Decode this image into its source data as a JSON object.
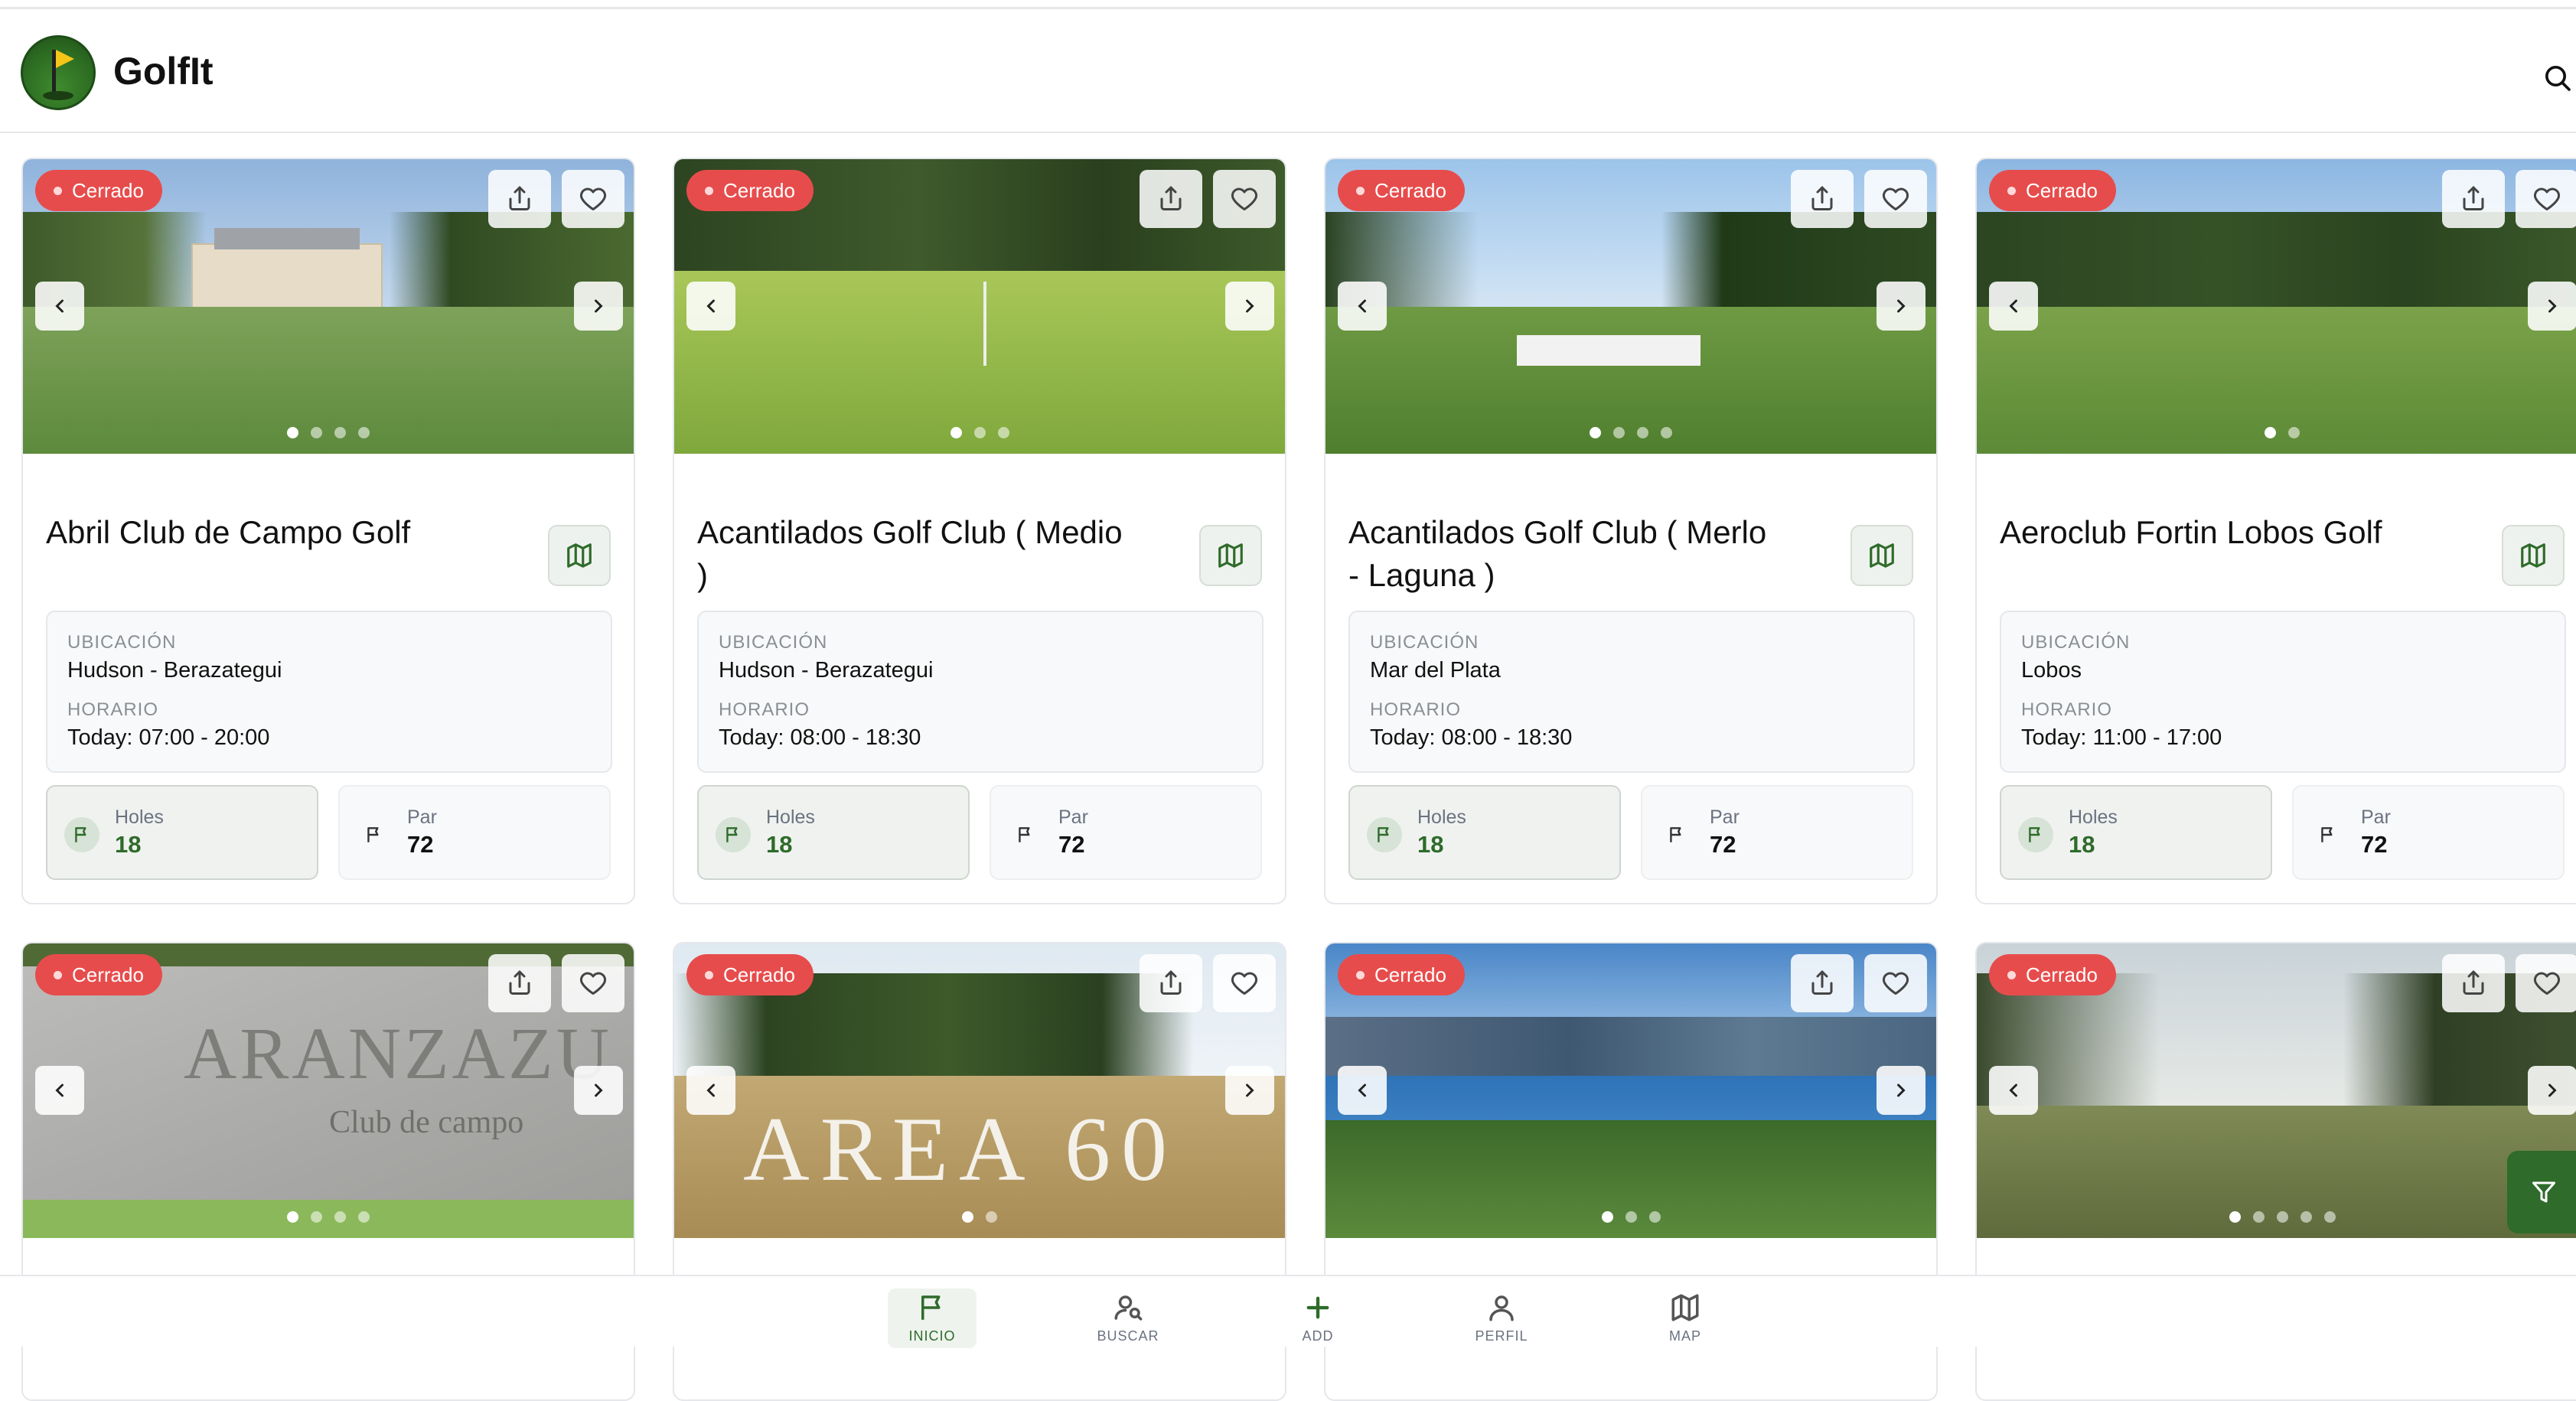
{
  "app": {
    "title": "GolfIt"
  },
  "header": {
    "search_icon": "search-icon"
  },
  "courses": [
    {
      "status": "Cerrado",
      "name": "Abril Club de Campo Golf",
      "location_label": "UBICACIÓN",
      "location": "Hudson - Berazategui",
      "hours_label": "HORARIO",
      "hours": "Today: 07:00 - 20:00",
      "holes_label": "Holes",
      "holes": "18",
      "par_label": "Par",
      "par": "72",
      "photos": 4,
      "active_photo": 1
    },
    {
      "status": "Cerrado",
      "name": "Acantilados Golf Club ( Medio )",
      "location_label": "UBICACIÓN",
      "location": "Hudson - Berazategui",
      "hours_label": "HORARIO",
      "hours": "Today: 08:00 - 18:30",
      "holes_label": "Holes",
      "holes": "18",
      "par_label": "Par",
      "par": "72",
      "photos": 3,
      "active_photo": 1
    },
    {
      "status": "Cerrado",
      "name": "Acantilados Golf Club ( Merlo - Laguna )",
      "location_label": "UBICACIÓN",
      "location": "Mar del Plata",
      "hours_label": "HORARIO",
      "hours": "Today: 08:00 - 18:30",
      "holes_label": "Holes",
      "holes": "18",
      "par_label": "Par",
      "par": "72",
      "photos": 4,
      "active_photo": 1
    },
    {
      "status": "Cerrado",
      "name": "Aeroclub Fortin Lobos Golf",
      "location_label": "UBICACIÓN",
      "location": "Lobos",
      "hours_label": "HORARIO",
      "hours": "Today: 11:00 - 17:00",
      "holes_label": "Holes",
      "holes": "18",
      "par_label": "Par",
      "par": "72",
      "photos": 2,
      "active_photo": 1
    },
    {
      "status": "Cerrado",
      "photos": 4,
      "active_photo": 1,
      "sign_text": "ARANZAZU",
      "sign_sub": "Club de campo"
    },
    {
      "status": "Cerrado",
      "photos": 2,
      "active_photo": 1,
      "sign_text": "AREA 60"
    },
    {
      "status": "Cerrado",
      "photos": 3,
      "active_photo": 1
    },
    {
      "status": "Cerrado",
      "photos": 5,
      "active_photo": 1
    }
  ],
  "bottom_nav": [
    {
      "label": "INICIO",
      "icon": "flag-icon",
      "active": true
    },
    {
      "label": "BUSCAR",
      "icon": "user-search-icon",
      "active": false
    },
    {
      "label": "ADD",
      "icon": "plus-icon",
      "active": false
    },
    {
      "label": "PERFIL",
      "icon": "user-icon",
      "active": false
    },
    {
      "label": "MAP",
      "icon": "map-icon",
      "active": false
    }
  ],
  "colors": {
    "brand_green": "#2e6b2a",
    "closed_badge": "#e74c4c"
  }
}
